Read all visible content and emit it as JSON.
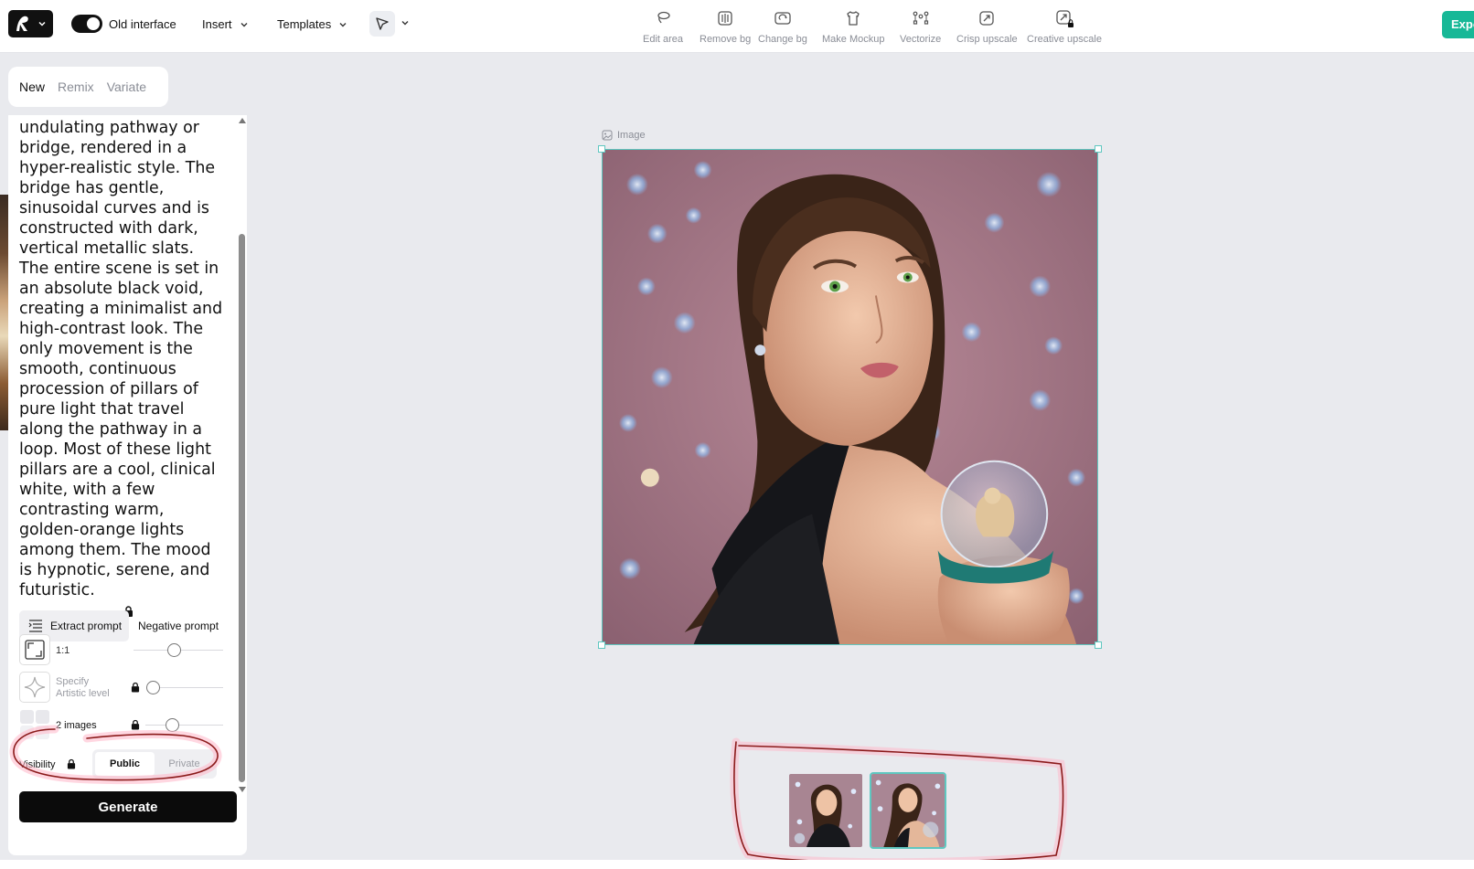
{
  "topbar": {
    "old_interface_label": "Old interface",
    "insert_label": "Insert",
    "templates_label": "Templates",
    "tools": [
      {
        "label": "Edit area",
        "icon": "lasso-icon"
      },
      {
        "label": "Remove bg",
        "icon": "remove-bg-icon"
      },
      {
        "label": "Change bg",
        "icon": "change-bg-icon"
      },
      {
        "label": "Make Mockup",
        "icon": "tshirt-icon"
      },
      {
        "label": "Vectorize",
        "icon": "vector-nodes-icon"
      },
      {
        "label": "Crisp upscale",
        "icon": "upscale-icon"
      },
      {
        "label": "Creative upscale",
        "icon": "creative-upscale-icon"
      }
    ],
    "export_label": "Expo"
  },
  "left_panel": {
    "tabs": [
      {
        "label": "New",
        "active": true
      },
      {
        "label": "Remix",
        "active": false
      },
      {
        "label": "Variate",
        "active": false
      }
    ],
    "prompt_text": "undulating pathway or bridge, rendered in a hyper-realistic style. The bridge has gentle, sinusoidal curves and is constructed with dark, vertical metallic slats. The entire scene is set in an absolute black void, creating a minimalist and high-contrast look. The only movement is the smooth, continuous procession of pillars of pure light that travel along the pathway in a loop. Most of these light pillars are a cool, clinical white, with a few contrasting warm, golden-orange lights among them. The mood is hypnotic, serene, and futuristic.",
    "extract_prompt_label": "Extract prompt",
    "negative_prompt_label": "Negative prompt",
    "aspect_ratio": {
      "label": "1:1",
      "slider_fraction": 0.45
    },
    "artistic_level": {
      "label_line1": "Specify",
      "label_line2": "Artistic level",
      "slider_fraction": 0.0
    },
    "images_count": {
      "label": "2 images",
      "slider_fraction": 0.3
    },
    "visibility": {
      "label": "Visibility",
      "options": [
        "Public",
        "Private"
      ],
      "selected": "Public"
    },
    "generate_label": "Generate"
  },
  "canvas": {
    "image_label": "Image",
    "thumbnails_count": 2,
    "selected_thumbnail": 2
  },
  "colors": {
    "accent": "#17b897",
    "selection": "#5fc7c0",
    "annotation": "#8b1a1a"
  }
}
